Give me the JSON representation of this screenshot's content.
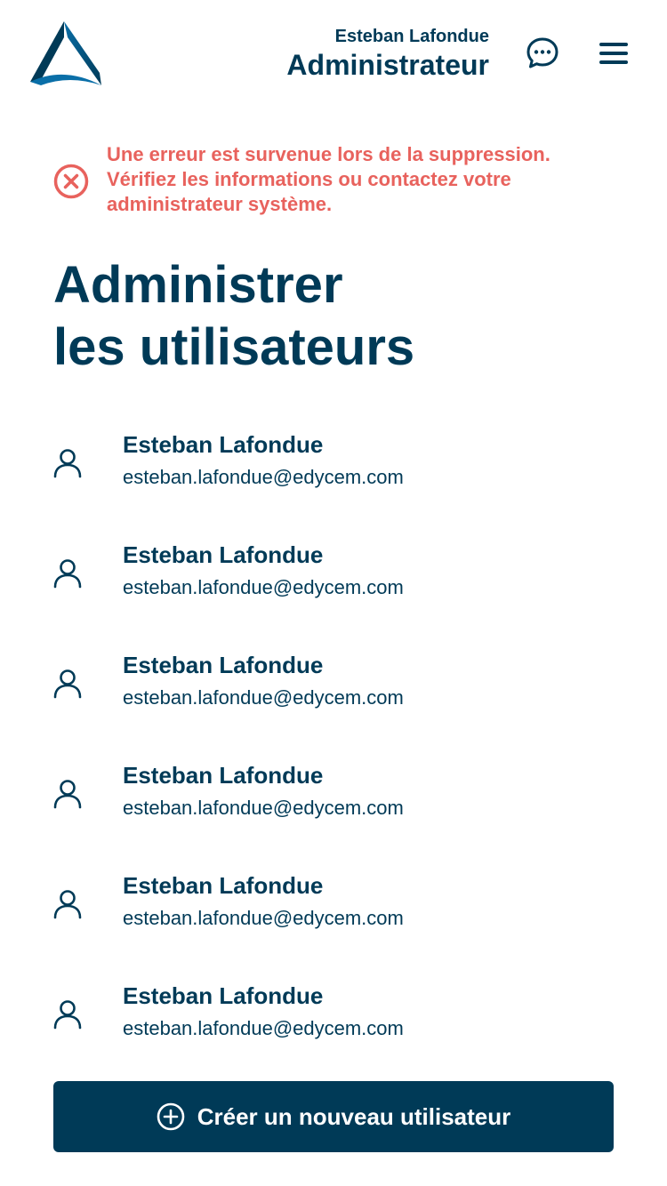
{
  "header": {
    "user_name": "Esteban Lafondue",
    "user_role": "Administrateur",
    "icons": {
      "logo": "triangle-logo",
      "chat": "chat-bubble-icon",
      "menu": "hamburger-menu-icon"
    }
  },
  "error": {
    "message": "Une erreur est survenue lors de la suppression. Vérifiez les informations ou contactez votre administrateur système.",
    "icon": "error-x-circle-icon",
    "color": "#e8625d"
  },
  "page": {
    "title_line1": "Administrer",
    "title_line2": "les utilisateurs"
  },
  "users": [
    {
      "name": "Esteban Lafondue",
      "email": "esteban.lafondue@edycem.com"
    },
    {
      "name": "Esteban Lafondue",
      "email": "esteban.lafondue@edycem.com"
    },
    {
      "name": "Esteban Lafondue",
      "email": "esteban.lafondue@edycem.com"
    },
    {
      "name": "Esteban Lafondue",
      "email": "esteban.lafondue@edycem.com"
    },
    {
      "name": "Esteban Lafondue",
      "email": "esteban.lafondue@edycem.com"
    },
    {
      "name": "Esteban Lafondue",
      "email": "esteban.lafondue@edycem.com"
    }
  ],
  "actions": {
    "create_label": "Créer un nouveau utilisateur",
    "create_icon": "plus-circle-icon"
  },
  "colors": {
    "primary": "#003a57",
    "error": "#e8625d",
    "background": "#ffffff"
  }
}
